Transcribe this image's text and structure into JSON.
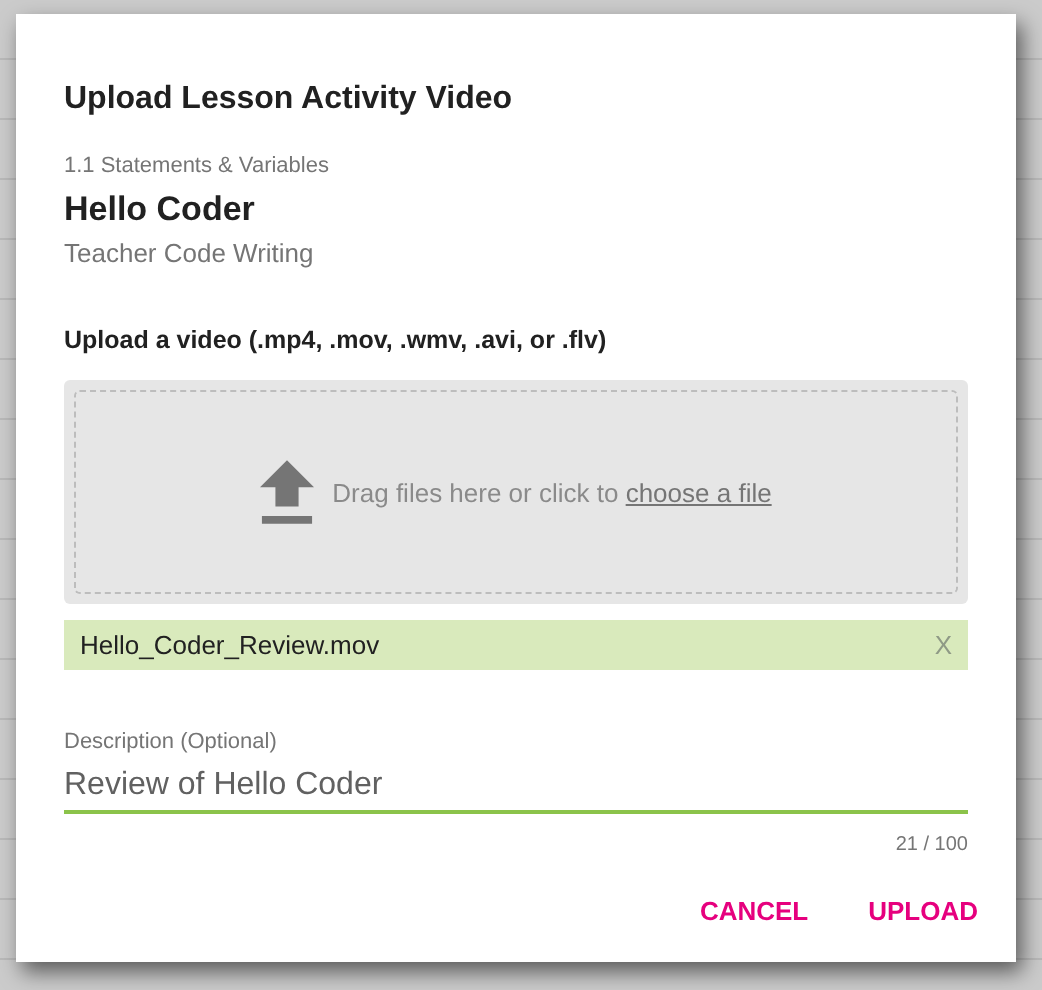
{
  "dialog": {
    "title": "Upload Lesson Activity Video",
    "lesson": "1.1 Statements & Variables",
    "activity": "Hello Coder",
    "activity_type": "Teacher Code Writing",
    "upload_label": "Upload a video (.mp4, .mov, .wmv, .avi, or .flv)",
    "dropzone": {
      "text": "Drag files here or click to",
      "link": "choose a file"
    },
    "files": [
      {
        "name": "Hello_Coder_Review.mov",
        "remove": "X"
      }
    ],
    "description": {
      "label": "Description (Optional)",
      "value": "Review of Hello Coder",
      "focused": true,
      "counter": "21 / 100"
    },
    "buttons": [
      "CANCEL",
      "UPLOAD"
    ]
  }
}
